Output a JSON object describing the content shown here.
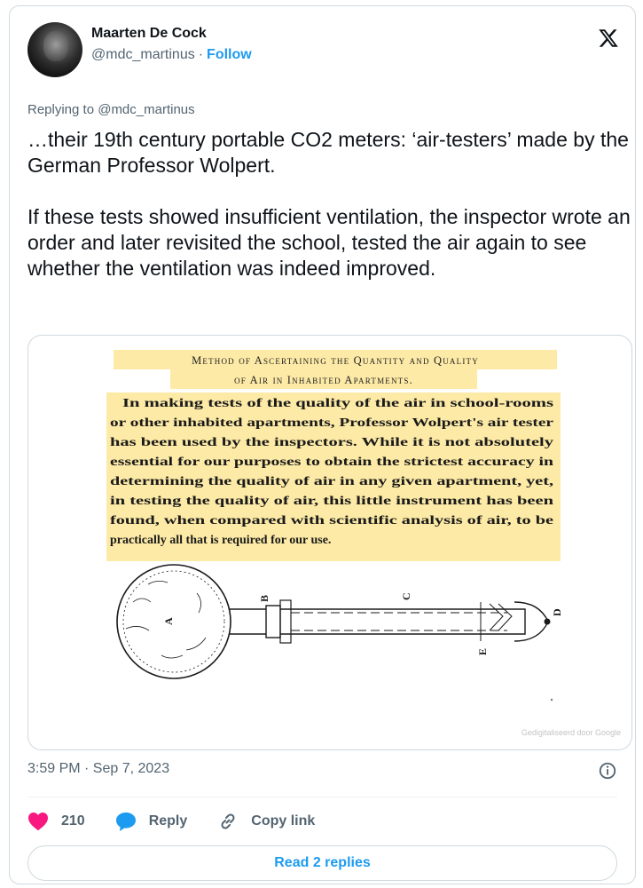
{
  "author": {
    "name": "Maarten De Cock",
    "handle": "@mdc_martinus",
    "separator": "·",
    "follow_label": "Follow"
  },
  "reply_to": "Replying to @mdc_martinus",
  "tweet": {
    "paragraph_1": "…their 19th century portable CO2 meters: ‘air-testers’ made by the German Professor Wolpert.",
    "paragraph_2": "If these tests showed insufficient ventilation, the inspector wrote an order and later revisited the school, tested the air again to see whether the ventilation was indeed improved."
  },
  "media": {
    "heading_line_1": "Method of Ascertaining the Quantity and Quality",
    "heading_line_2": "of Air in Inhabited Apartments.",
    "body_lines": [
      "In making tests of the quality of the air in school-rooms",
      "or other inhabited apartments, Professor Wolpert's air tester",
      "has been used by the inspectors.   While it is not absolutely",
      "essential for our purposes to obtain the strictest accuracy in",
      "determining the quality of air in any given apartment, yet,",
      "in testing the quality of air, this little instrument has been",
      "found, when compared with scientific analysis of air, to be",
      "practically all that is required for our use."
    ],
    "diagram_labels": {
      "a": "A",
      "b": "B",
      "c": "C",
      "d": "D",
      "e": "E"
    },
    "watermark": "Gedigitaliseerd door Google"
  },
  "timestamp": "3:59 PM · Sep 7, 2023",
  "actions": {
    "likes": "210",
    "reply_label": "Reply",
    "copy_label": "Copy link"
  },
  "read_replies_label": "Read 2 replies",
  "colors": {
    "accent": "#1d9bf0",
    "like": "#f91880",
    "text": "#0f1419",
    "muted": "#536471",
    "border": "#cfd9de",
    "highlight": "#fdeaa6"
  },
  "icons": {
    "logo": "x-logo-icon",
    "info": "info-icon",
    "like": "heart-icon",
    "reply": "speech-bubble-icon",
    "copy": "link-icon"
  }
}
